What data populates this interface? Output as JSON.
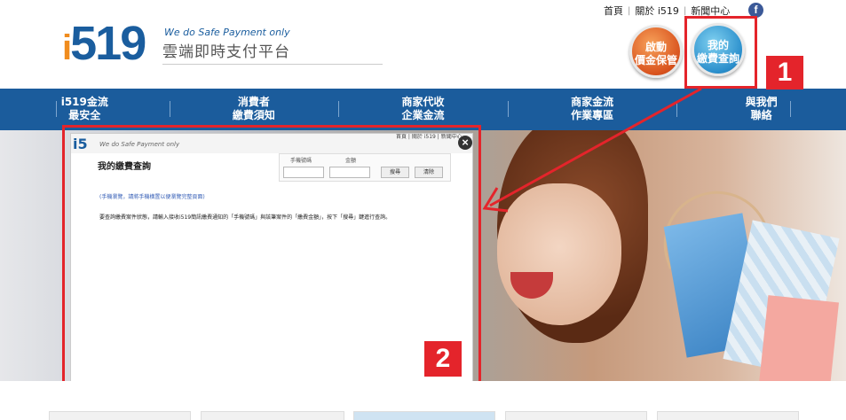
{
  "header": {
    "logo_text": "519",
    "logo_prefix": "i",
    "tagline": "We do Safe Payment only",
    "subtitle": "雲端即時支付平台",
    "top_links": [
      "首頁",
      "關於 i519",
      "新聞中心"
    ],
    "fb_glyph": "f",
    "buttons": {
      "activate": "啟動\n價金保管",
      "query": "我的\n繳費查詢"
    }
  },
  "nav": {
    "items": [
      "i519金流\n最安全",
      "消費者\n繳費須知",
      "商家代收\n企業金流",
      "商家金流\n作業專區",
      "與我們\n聯絡"
    ]
  },
  "annotations": {
    "badge1": "1",
    "badge2": "2",
    "color": "#e4242b"
  },
  "modal": {
    "ghost_logo": "i5",
    "ghost_tagline": "We do Safe Payment only",
    "ghost_links": "首頁 | 關於 i519 | 新聞中心",
    "close_glyph": "×",
    "title": "我的繳費查詢",
    "form": {
      "phone_label": "手機號碼",
      "amount_label": "金額",
      "search_button": "搜尋",
      "clear_button": "清除"
    },
    "note": "(手機瀏覽，請將手機橫置以便瀏覽完整頁面)",
    "description": "要查詢繳費案件狀態，請輸入接收i519簡訊繳費通知的「手機號碼」與該筆案件的「繳費金額」，按下「搜尋」鍵進行查詢。"
  },
  "colors": {
    "brand_blue": "#1b5c9c",
    "accent_orange": "#f08c1e"
  }
}
